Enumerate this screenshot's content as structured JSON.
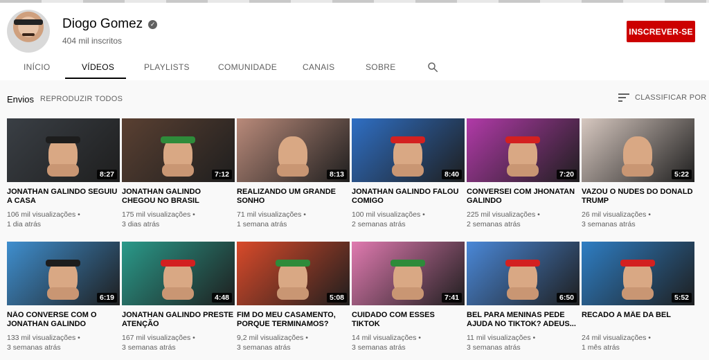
{
  "channel": {
    "name": "Diogo Gomez",
    "subscribers": "404 mil inscritos",
    "subscribe_label": "INSCREVER-SE",
    "verified_glyph": "✓"
  },
  "tabs": [
    "INÍCIO",
    "VÍDEOS",
    "PLAYLISTS",
    "COMUNIDADE",
    "CANAIS",
    "SOBRE"
  ],
  "active_tab": "VÍDEOS",
  "section": {
    "title": "Envios",
    "play_all": "REPRODUZIR TODOS",
    "sort_label": "CLASSIFICAR POR"
  },
  "colors": {
    "accent": "#cc0000"
  },
  "videos": [
    {
      "title": "JONATHAN GALINDO SEGUIU A CASA",
      "views": "106 mil visualizações",
      "age": "1 dia atrás",
      "duration": "8:27",
      "bg": "#3a3f45",
      "bandana": "#1d1d1d"
    },
    {
      "title": "JONATHAN GALINDO CHEGOU NO BRASIL",
      "views": "175 mil visualizações",
      "age": "3 dias atrás",
      "duration": "7:12",
      "bg": "#5a4032",
      "bandana": "#2e8b3a"
    },
    {
      "title": "REALIZANDO UM GRANDE SONHO",
      "views": "71 mil visualizações",
      "age": "1 semana atrás",
      "duration": "8:13",
      "bg": "#b98a7a",
      "bandana": ""
    },
    {
      "title": "JONATHAN GALINDO FALOU COMIGO",
      "views": "100 mil visualizações",
      "age": "2 semanas atrás",
      "duration": "8:40",
      "bg": "#2f6fc4",
      "bandana": "#d32020"
    },
    {
      "title": "CONVERSEI COM JHONATAN GALINDO",
      "views": "225 mil visualizações",
      "age": "2 semanas atrás",
      "duration": "7:20",
      "bg": "#b13aa8",
      "bandana": "#d32020"
    },
    {
      "title": "VAZOU O NUDES DO DONALD TRUMP",
      "views": "26 mil visualizações",
      "age": "3 semanas atrás",
      "duration": "5:22",
      "bg": "#d7c8c0",
      "bandana": ""
    },
    {
      "title": "NÃO CONVERSE COM O JONATHAN GALINDO",
      "views": "133 mil visualizações",
      "age": "3 semanas atrás",
      "duration": "6:19",
      "bg": "#3f8fcf",
      "bandana": "#1d1d1d"
    },
    {
      "title": "JONATHAN GALINDO PRESTE ATENÇÃO",
      "views": "167 mil visualizações",
      "age": "3 semanas atrás",
      "duration": "4:48",
      "bg": "#2a9a8a",
      "bandana": "#d32020"
    },
    {
      "title": "FIM DO MEU CASAMENTO, PORQUE TERMINAMOS?",
      "views": "9,2 mil visualizações",
      "age": "3 semanas atrás",
      "duration": "5:08",
      "bg": "#d94a2a",
      "bandana": "#2e8b3a"
    },
    {
      "title": "CUIDADO COM ESSES TIKTOK",
      "views": "14 mil visualizações",
      "age": "3 semanas atrás",
      "duration": "7:41",
      "bg": "#e07ab0",
      "bandana": "#2e8b3a"
    },
    {
      "title": "BEL PARA MENINAS PEDE AJUDA NO TIKTOK? ADEUS...",
      "views": "11 mil visualizações",
      "age": "3 semanas atrás",
      "duration": "6:50",
      "bg": "#4a88d8",
      "bandana": "#d32020"
    },
    {
      "title": "RECADO A MÃE DA BEL",
      "views": "24 mil visualizações",
      "age": "1 mês atrás",
      "duration": "5:52",
      "bg": "#2e7ec4",
      "bandana": "#d32020"
    }
  ]
}
